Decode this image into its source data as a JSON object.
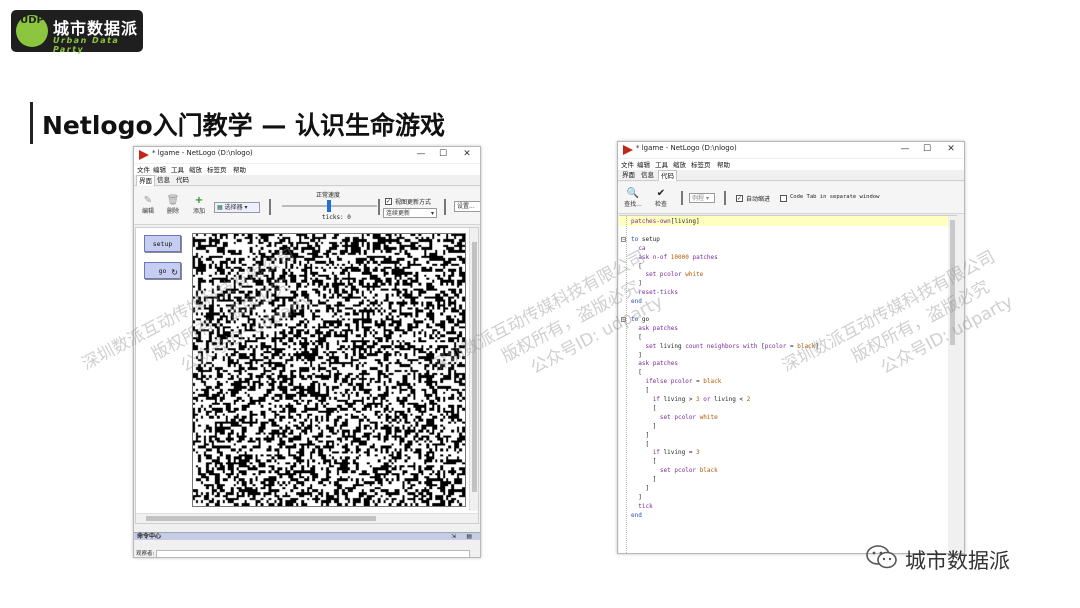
{
  "logo": {
    "badge": "UDP",
    "name_cn": "城市数据派",
    "name_en": "Urban Data Party"
  },
  "slide_title": "Netlogo入门教学 — 认识生命游戏",
  "window_left": {
    "title": "* lgame - NetLogo (D:\\nlogo)",
    "menu": [
      "文件",
      "编辑",
      "工具",
      "缩放",
      "标签页",
      "帮助"
    ],
    "tabs": [
      "界面",
      "信息",
      "代码"
    ],
    "active_tab": "界面",
    "toolbar": {
      "edit": "编辑",
      "delete": "删除",
      "add": "添加",
      "selector": "选择器",
      "speed_label": "正常速度",
      "ticks": "ticks: 0",
      "view_update_label": "视图更新方式",
      "update_mode": "连续更新",
      "settings": "设置..."
    },
    "buttons": {
      "setup": "setup",
      "go": "go"
    },
    "command_center": "命令中心",
    "observer": "观察者:"
  },
  "window_right": {
    "title": "* lgame - NetLogo (D:\\nlogo)",
    "menu": [
      "文件",
      "编辑",
      "工具",
      "缩放",
      "标签页",
      "帮助"
    ],
    "tabs": [
      "界面",
      "信息",
      "代码"
    ],
    "active_tab": "代码",
    "toolbar": {
      "find": "查找...",
      "check": "检查",
      "procedures": "例程",
      "auto_indent": "自动缩进",
      "separate_window": "Code Tab in separate window"
    },
    "code": [
      "patches-own[living]",
      "",
      "to setup",
      "  ca",
      "  ask n-of 10000 patches",
      "  [",
      "    set pcolor white",
      "  ]",
      "  reset-ticks",
      "end",
      "",
      "to go",
      "  ask patches",
      "  [",
      "    set living count neighbors with [pcolor = black]",
      "  ]",
      "  ask patches",
      "  [",
      "    ifelse pcolor = black",
      "    [",
      "      if living > 3 or living < 2",
      "      [",
      "        set pcolor white",
      "      ]",
      "    ]",
      "    [",
      "      if living = 3",
      "      [",
      "        set pcolor black",
      "      ]",
      "    ]",
      "  ]",
      "  tick",
      "end"
    ]
  },
  "watermark": {
    "line1": "深圳数派互动传媒科技有限公司",
    "line2": "版权所有，盗版必究",
    "line3": "公众号ID: udparty"
  },
  "wechat": {
    "name": "城市数据派"
  },
  "colors": {
    "brand_green": "#8cc63f",
    "netlogo_button": "#c5cdf0",
    "code_highlight": "#ffffc0",
    "keyword_blue": "#2a4fb8",
    "primitive_purple": "#7a2a9a",
    "constant_orange": "#b35a00"
  }
}
